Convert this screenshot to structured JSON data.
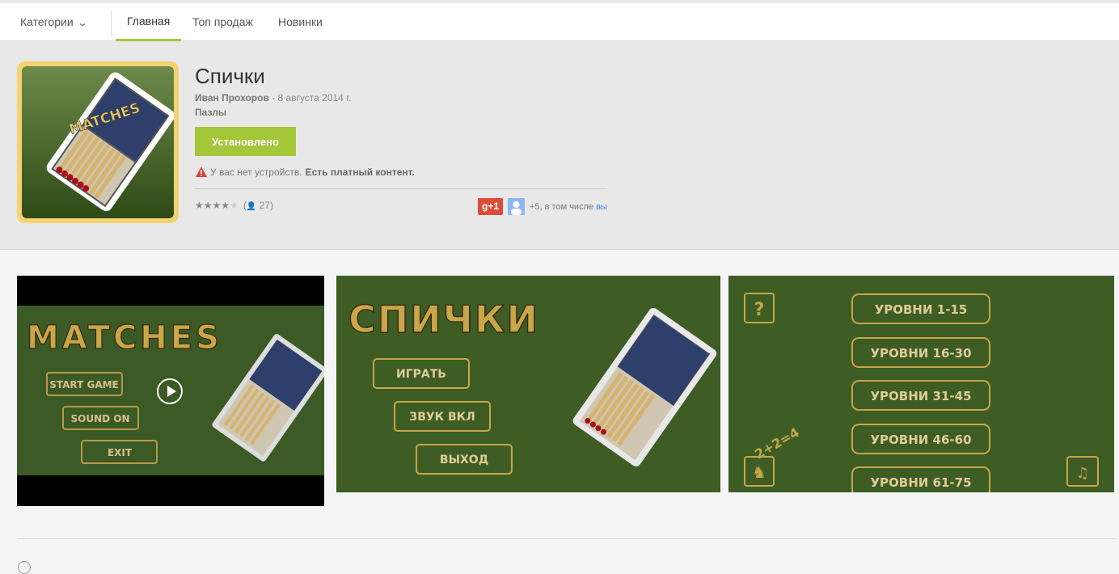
{
  "nav": {
    "categories_label": "Категории",
    "tabs": [
      {
        "label": "Главная",
        "active": true
      },
      {
        "label": "Топ продаж",
        "active": false
      },
      {
        "label": "Новинки",
        "active": false
      }
    ]
  },
  "app": {
    "title": "Спички",
    "developer": "Иван Прохоров",
    "date": " - 8 августа 2014 г.",
    "genre": "Пазлы",
    "install_label": "Установлено",
    "warning_text": "У вас нет устройств.",
    "warning_bold": "Есть платный контент.",
    "rating_count": "27",
    "rating_stars": 4,
    "gplus_label": "g+1",
    "social_text": "+5, в том числе",
    "social_link": "вы",
    "icon_text": "MATCHES"
  },
  "screenshots": {
    "video": {
      "title": "MATCHES",
      "buttons": [
        "START GAME",
        "SOUND ON",
        "EXIT"
      ]
    },
    "menu": {
      "title": "СПИЧКИ",
      "buttons": [
        "ИГРАТЬ",
        "ЗВУК ВКЛ",
        "ВЫХОД"
      ]
    },
    "levels": {
      "buttons": [
        "УРОВНИ 1-15",
        "УРОВНИ 16-30",
        "УРОВНИ 31-45",
        "УРОВНИ 46-60",
        "УРОВНИ 61-75"
      ],
      "equation": "2+2=4"
    }
  },
  "colors": {
    "accent": "#a4c639",
    "gplus": "#dd4b39",
    "link": "#427fed",
    "game_green": "#3a5a20",
    "button_gold": "#c8a64a"
  }
}
